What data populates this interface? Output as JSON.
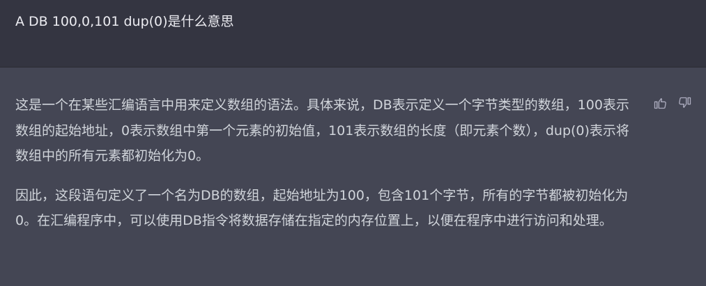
{
  "user_message": {
    "text": "A DB  100,0,101 dup(0)是什么意思"
  },
  "assistant_message": {
    "paragraphs": [
      "这是一个在某些汇编语言中用来定义数组的语法。具体来说，DB表示定义一个字节类型的数组，100表示数组的起始地址，0表示数组中第一个元素的初始值，101表示数组的长度（即元素个数），dup(0)表示将数组中的所有元素都初始化为0。",
      "因此，这段语句定义了一个名为DB的数组，起始地址为100，包含101个字节，所有的字节都被初始化为0。在汇编程序中，可以使用DB指令将数据存储在指定的内存位置上，以便在程序中进行访问和处理。"
    ]
  },
  "feedback": {
    "thumbs_up_icon": "thumbs-up-icon",
    "thumbs_down_icon": "thumbs-down-icon"
  },
  "colors": {
    "user_bg": "#343541",
    "assistant_bg": "#444654",
    "text": "#d1d5db",
    "icon": "#acacbe"
  }
}
